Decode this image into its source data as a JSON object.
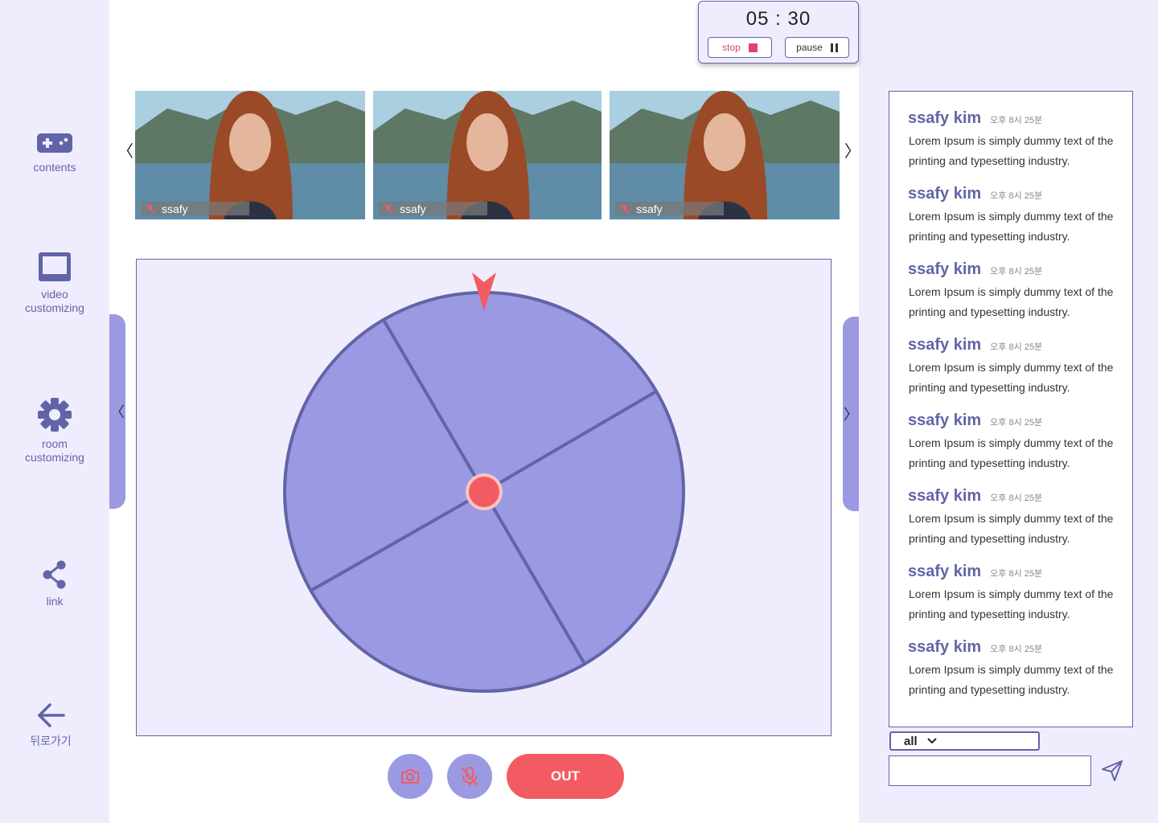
{
  "sidebar": {
    "items": [
      {
        "label": "contents",
        "icon": "gamepad-icon"
      },
      {
        "label": "video\ncustomizing",
        "icon": "monitor-icon"
      },
      {
        "label": "room\ncustomizing",
        "icon": "gear-icon"
      },
      {
        "label": "link",
        "icon": "share-icon"
      },
      {
        "label": "뒤로가기",
        "icon": "arrow-left-icon"
      }
    ]
  },
  "timer": {
    "time": "05 : 30",
    "stop_label": "stop",
    "pause_label": "pause"
  },
  "videos": [
    {
      "name": "ssafy",
      "muted": true
    },
    {
      "name": "ssafy",
      "muted": true
    },
    {
      "name": "ssafy",
      "muted": true
    }
  ],
  "nav": {
    "prev": "〈",
    "next": "〉"
  },
  "roulette": {
    "segments": 4,
    "colors": {
      "fill": "#9b99e1",
      "stroke": "#6264a7",
      "pointer": "#f35b63",
      "hub": "#f35b63",
      "hub_ring": "#f6c3c6"
    }
  },
  "controls": {
    "out_label": "OUT",
    "camera_icon": "camera-icon",
    "mic_icon": "mic-off-icon"
  },
  "chat": {
    "messages": [
      {
        "user": "ssafy kim",
        "time": "오후 8시 25분",
        "text": "Lorem Ipsum is simply dummy text of the printing and typesetting industry."
      },
      {
        "user": "ssafy kim",
        "time": "오후 8시 25분",
        "text": "Lorem Ipsum is simply dummy text of the printing and typesetting industry."
      },
      {
        "user": "ssafy kim",
        "time": "오후 8시 25분",
        "text": "Lorem Ipsum is simply dummy text of the printing and typesetting industry."
      },
      {
        "user": "ssafy kim",
        "time": "오후 8시 25분",
        "text": "Lorem Ipsum is simply dummy text of the printing and typesetting industry."
      },
      {
        "user": "ssafy kim",
        "time": "오후 8시 25분",
        "text": "Lorem Ipsum is simply dummy text of the printing and typesetting industry."
      },
      {
        "user": "ssafy kim",
        "time": "오후 8시 25분",
        "text": "Lorem Ipsum is simply dummy text of the printing and typesetting industry."
      },
      {
        "user": "ssafy kim",
        "time": "오후 8시 25분",
        "text": "Lorem Ipsum is simply dummy text of the printing and typesetting industry."
      },
      {
        "user": "ssafy kim",
        "time": "오후 8시 25분",
        "text": "Lorem Ipsum is simply dummy text of the printing and typesetting industry."
      }
    ],
    "scope": "all",
    "input_value": "",
    "input_placeholder": ""
  },
  "colors": {
    "accent": "#6264a7",
    "accent_light": "#9b99e1",
    "panel_bg": "#efedfd",
    "danger": "#f35b63",
    "stop": "#e0407a"
  }
}
